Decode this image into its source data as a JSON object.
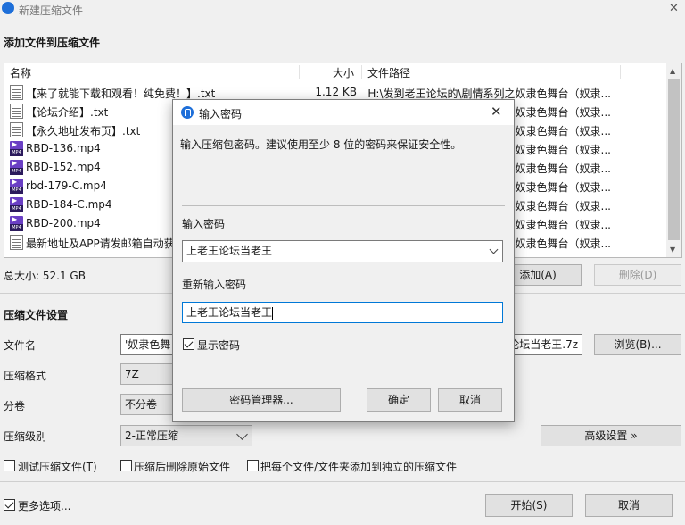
{
  "window": {
    "title": "新建压缩文件",
    "close_glyph": "✕"
  },
  "files_section": {
    "heading": "添加文件到压缩文件",
    "columns": {
      "name": "名称",
      "size": "大小",
      "path": "文件路径"
    },
    "rows": [
      {
        "name": "【来了就能下载和观看！纯免费！】.txt",
        "size": "1.12 KB",
        "path": "H:\\发到老王论坛的\\剧情系列之奴隶色舞台（奴隶...",
        "type": "txt"
      },
      {
        "name": "【论坛介绍】.txt",
        "size": "",
        "path": "奴隶色舞台（奴隶...",
        "type": "txt"
      },
      {
        "name": "【永久地址发布页】.txt",
        "size": "",
        "path": "奴隶色舞台（奴隶...",
        "type": "txt"
      },
      {
        "name": "RBD-136.mp4",
        "size": "",
        "path": "奴隶色舞台（奴隶...",
        "type": "mp4"
      },
      {
        "name": "RBD-152.mp4",
        "size": "",
        "path": "奴隶色舞台（奴隶...",
        "type": "mp4"
      },
      {
        "name": "rbd-179-C.mp4",
        "size": "",
        "path": "奴隶色舞台（奴隶...",
        "type": "mp4"
      },
      {
        "name": "RBD-184-C.mp4",
        "size": "",
        "path": "奴隶色舞台（奴隶...",
        "type": "mp4"
      },
      {
        "name": "RBD-200.mp4",
        "size": "",
        "path": "奴隶色舞台（奴隶...",
        "type": "mp4"
      },
      {
        "name": "最新地址及APP请发邮箱自动获",
        "size": "",
        "path": "奴隶色舞台（奴隶...",
        "type": "txt"
      }
    ],
    "total_size": "总大小: 52.1 GB",
    "add_button": "添加(A)",
    "delete_button": "删除(D)"
  },
  "settings": {
    "heading": "压缩文件设置",
    "filename_label": "文件名",
    "filename_value_left": "'奴隶色舞",
    "filename_value_right": "论坛当老王.7z",
    "browse_button": "浏览(B)...",
    "format_label": "压缩格式",
    "format_value": "7Z",
    "split_label": "分卷",
    "split_value": "不分卷",
    "level_label": "压缩级别",
    "level_value": "2-正常压缩",
    "advanced_button": "高级设置 »",
    "test_checkbox": "测试压缩文件(T)",
    "delete_after_checkbox": "压缩后删除原始文件",
    "separate_checkbox": "把每个文件/文件夹添加到独立的压缩文件",
    "more_options": "更多选项...",
    "start_button": "开始(S)",
    "cancel_button": "取消"
  },
  "dialog": {
    "title": "输入密码",
    "close_glyph": "✕",
    "description": "输入压缩包密码。建议使用至少 8 位的密码来保证安全性。",
    "password_label": "输入密码",
    "password_value": "上老王论坛当老王",
    "reenter_label": "重新输入密码",
    "reenter_value": "上老王论坛当老王",
    "show_password": "显示密码",
    "manager_button": "密码管理器...",
    "ok_button": "确定",
    "cancel_button": "取消"
  }
}
